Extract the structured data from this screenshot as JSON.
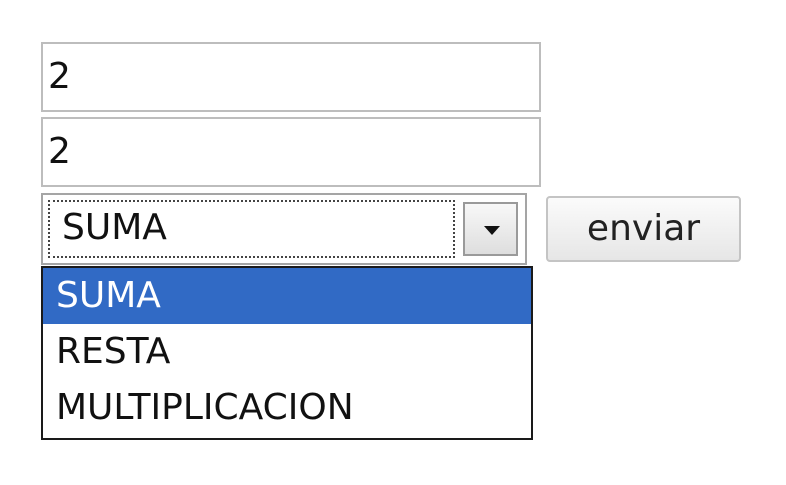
{
  "form": {
    "field1_value": "2",
    "field2_value": "2",
    "select_value": "SUMA",
    "submit_label": "enviar",
    "options": [
      {
        "label": "SUMA",
        "selected": true
      },
      {
        "label": "RESTA",
        "selected": false
      },
      {
        "label": "MULTIPLICACION",
        "selected": false
      }
    ]
  },
  "colors": {
    "selected_option_bg": "#316ac5",
    "selected_option_text": "#ffffff"
  }
}
